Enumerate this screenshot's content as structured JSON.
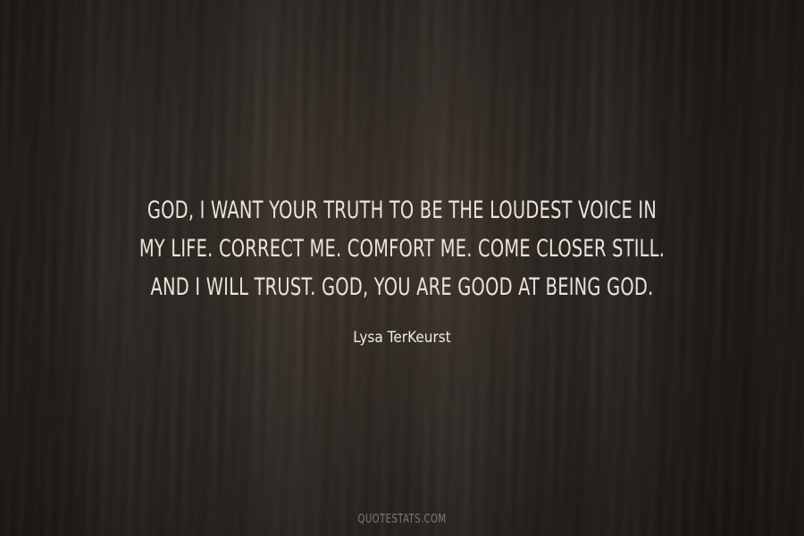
{
  "quote": {
    "lines": [
      "God, I want Your Truth to be the loudest voice in",
      "my life. Correct me. Comfort me. Come closer still.",
      "And I will trust. God, You are good at being God."
    ]
  },
  "author": "Lysa TerKeurst",
  "source": "QUOTESTATS.COM",
  "colors": {
    "background": "#3a332b",
    "text": "#e9e4dc"
  }
}
